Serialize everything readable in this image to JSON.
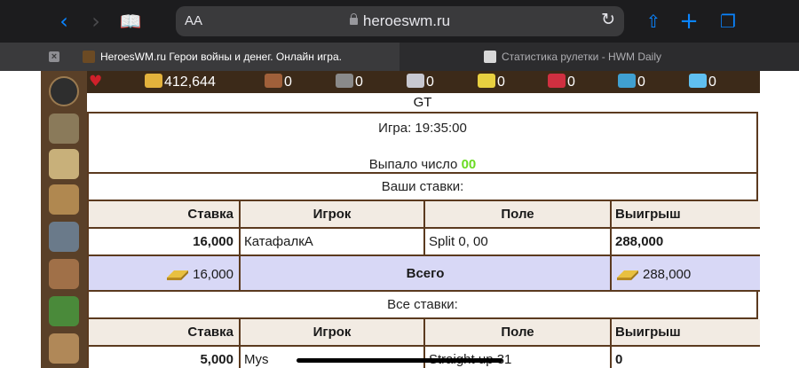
{
  "browser": {
    "text_size_label": "AA",
    "url": "heroeswm.ru",
    "tabs": [
      {
        "title": "HeroesWM.ru Герои войны и денег. Онлайн игра.",
        "active": true
      },
      {
        "title": "Статистика рулетки - HWM Daily",
        "active": false
      }
    ]
  },
  "resources": [
    {
      "name": "gold-icon",
      "value": "412,644",
      "color": "#e3b23c"
    },
    {
      "name": "wood-icon",
      "value": "0",
      "color": "#a0603a"
    },
    {
      "name": "ore-icon",
      "value": "0",
      "color": "#8a8a8a"
    },
    {
      "name": "mercury-icon",
      "value": "0",
      "color": "#c8c8d0"
    },
    {
      "name": "sulfur-icon",
      "value": "0",
      "color": "#e8d040"
    },
    {
      "name": "crystals-icon",
      "value": "0",
      "color": "#d03040"
    },
    {
      "name": "gems-icon",
      "value": "0",
      "color": "#40a0d0"
    },
    {
      "name": "diamond-icon",
      "value": "0",
      "color": "#60c0f0"
    }
  ],
  "page": {
    "title": "GT",
    "game_label": "Игра: 19:35:00",
    "result_label": "Выпало число",
    "result_number": "00",
    "your_bets_label": "Ваши ставки:",
    "all_bets_label": "Все ставки:",
    "columns": {
      "stake": "Ставка",
      "player": "Игрок",
      "field": "Поле",
      "win": "Выигрыш"
    },
    "your_bets": [
      {
        "stake": "16,000",
        "player": "КатафалкА",
        "field": "Split 0, 00",
        "win": "288,000"
      }
    ],
    "total": {
      "stake": "16,000",
      "label": "Всего",
      "win": "288,000"
    },
    "all_bets": [
      {
        "stake": "5,000",
        "player": "Mys",
        "field": "Straight up 31",
        "win": "0"
      }
    ]
  },
  "colors": {
    "accent": "#0a84ff",
    "table_border": "#5b3a1f",
    "total_row": "#d8d8f6",
    "result_number": "#6adb22"
  }
}
